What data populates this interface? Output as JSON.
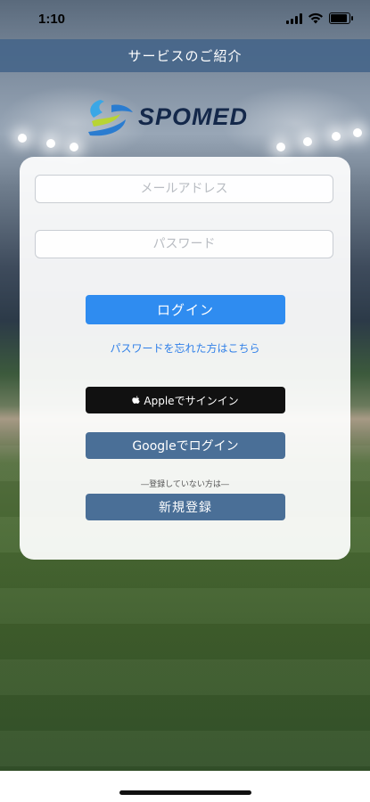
{
  "status_bar": {
    "time": "1:10"
  },
  "header": {
    "title": "サービスのご紹介"
  },
  "logo": {
    "text": "SPOMED"
  },
  "login_form": {
    "email_placeholder": "メールアドレス",
    "password_placeholder": "パスワード",
    "login_label": "ログイン",
    "forgot_password": "パスワードを忘れた方はこちら",
    "apple_label": "Appleでサインイン",
    "google_label": "Googleでログイン",
    "not_registered": "―登録していない方は―",
    "register_label": "新規登録"
  },
  "colors": {
    "header_bg": "#47668a",
    "primary_button": "#2f8cf0",
    "secondary_button": "#4a6f97",
    "apple_button": "#111111",
    "link": "#2f7fe8"
  }
}
